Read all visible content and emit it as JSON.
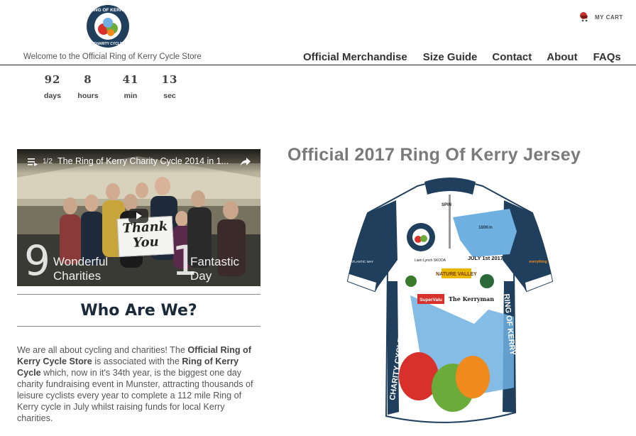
{
  "header": {
    "logo_text_top": "RING OF KERRY",
    "logo_text_bottom": "CHARITY CYCLE",
    "tagline": "Welcome to the Official Ring of Kerry Cycle Store",
    "cart_label": "MY CART",
    "cart_icon": "shopping-cart-icon"
  },
  "nav": {
    "items": [
      "Official Merchandise",
      "Size Guide",
      "Contact",
      "About",
      "FAQs"
    ]
  },
  "countdown": {
    "days": "92",
    "days_label": "days",
    "hours": "8",
    "hours_label": "hours",
    "min": "41",
    "min_label": "min",
    "sec": "13",
    "sec_label": "sec"
  },
  "video": {
    "playlist_count": "1/2",
    "title": "The Ring of Kerry Charity Cycle 2014 in 1...",
    "overlay_left_number": "9",
    "overlay_left_line1": "Wonderful",
    "overlay_left_line2": "Charities",
    "overlay_right_number": "1",
    "overlay_right_line1": "Fantastic",
    "overlay_right_line2": "Day",
    "sign_line1": "Thank",
    "sign_line2": "You",
    "icons": [
      "playlist-icon",
      "share-icon",
      "play-icon"
    ]
  },
  "about": {
    "heading": "Who Are We?",
    "p1": "We are all about cycling and charities! The ",
    "b1": "Official Ring of Kerry Cycle Store",
    "p2": " is associated with the ",
    "b2": "Ring of Kerry Cycle",
    "p3": " which, now in it's 34th year, is the biggest one day charity fundraising event in Munster, attracting thousands of leisure cyclists every year to complete a 112 mile Ring of Kerry cycle in July whilst raising funds for local Kerry charities."
  },
  "product": {
    "title": "Official 2017 Ring Of Kerry Jersey",
    "jersey_date": "JULY 1st 2017",
    "jersey_side_left": "CHARITY CYCLE",
    "jersey_side_right": "RING OF KERRY",
    "jersey_sponsors": [
      "SPIN",
      "NATURE VALLEY",
      "SuperValu",
      "The Kerryman",
      "Liam Lynch SKODA",
      "ATLANTIC WAY",
      "everything"
    ],
    "jersey_map_label": "180Km"
  },
  "colors": {
    "navy": "#1f3f5c",
    "sky": "#6fb0e0",
    "red": "#d8312c",
    "green": "#6bab3a",
    "orange": "#f08a1c"
  }
}
